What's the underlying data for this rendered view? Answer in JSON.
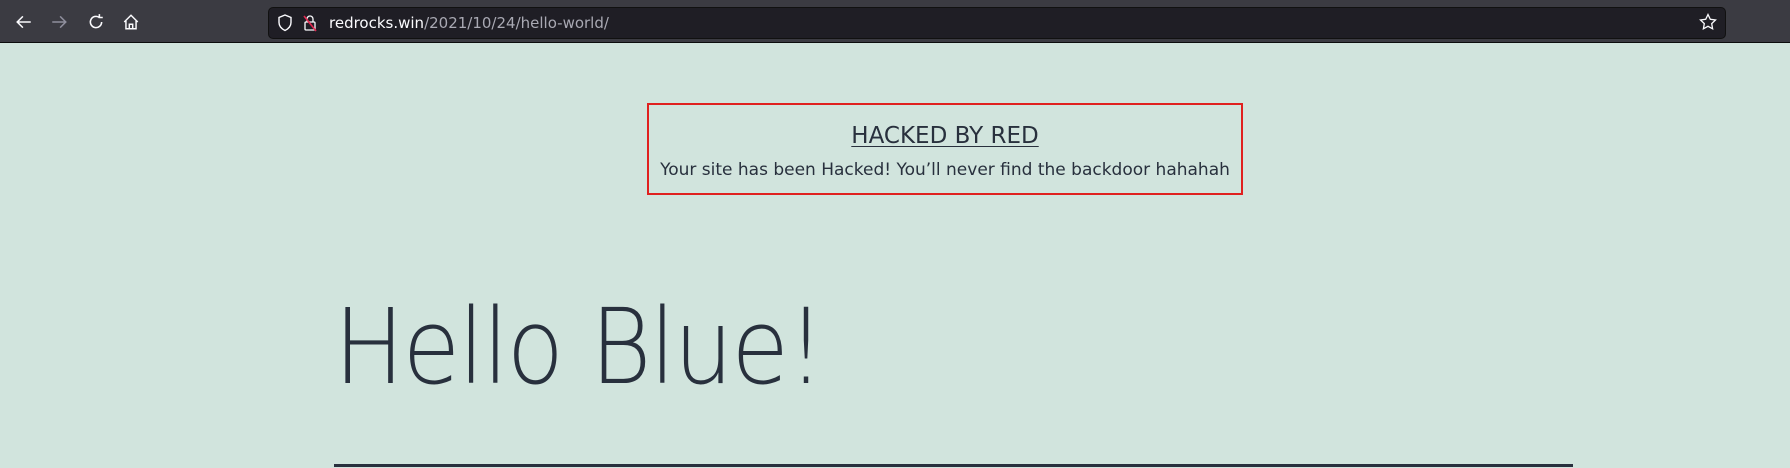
{
  "browser": {
    "url_host": "redrocks.win",
    "url_path": "/2021/10/24/hello-world/",
    "icons": [
      "back-icon",
      "forward-icon",
      "reload-icon",
      "home-icon",
      "shield-icon",
      "insecure-lock-icon",
      "bookmark-star-icon"
    ]
  },
  "banner": {
    "title": "HACKED BY RED",
    "message": "Your site has been Hacked! You’ll never find the backdoor hahahah",
    "border_color": "#e0201f"
  },
  "post": {
    "title": "Hello Blue!"
  },
  "colors": {
    "background": "#d1e4dd",
    "text": "#28303d"
  }
}
